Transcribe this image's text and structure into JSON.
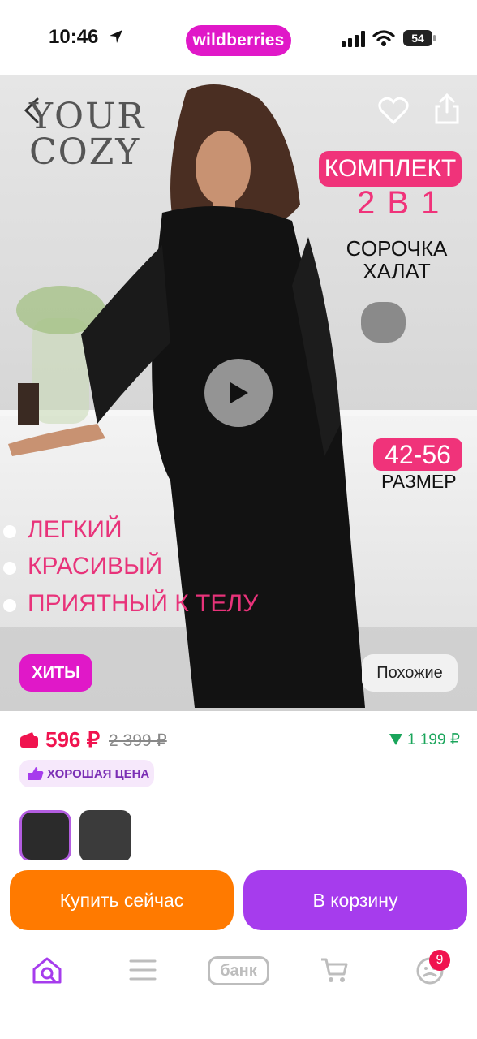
{
  "status_bar": {
    "time": "10:46",
    "app_name": "wildberries",
    "battery": "54"
  },
  "hero": {
    "logo_line1": "YOUR",
    "logo_line2": "COZY",
    "badge_set": "КОМПЛЕКТ",
    "two_in_one": "2 В 1",
    "item1": "СОРОЧКА",
    "item2": "ХАЛАТ",
    "size_range": "42-56",
    "size_label": "РАЗМЕР",
    "features": [
      "ЛЕГКИЙ",
      "КРАСИВЫЙ",
      "ПРИЯТНЫЙ К ТЕЛУ"
    ],
    "hits_label": "ХИТЫ",
    "similar_label": "Похожие"
  },
  "price": {
    "current": "596 ₽",
    "old": "2 399 ₽",
    "credit": "1 199 ₽",
    "good_price_label": "ХОРОШАЯ ЦЕНА"
  },
  "actions": {
    "buy_now": "Купить сейчас",
    "add_to_cart": "В корзину"
  },
  "tabbar": {
    "bank_label": "банк",
    "notifications": "9"
  },
  "colors": {
    "brand": "#e018c8",
    "accent_pink": "#f0337a",
    "price_red": "#f0134f",
    "buy_orange": "#ff7a00",
    "cart_purple": "#a63ced",
    "credit_green": "#1aa55b"
  },
  "icons": [
    "location-arrow-icon",
    "signal-icon",
    "wifi-icon",
    "battery-icon",
    "back-icon",
    "heart-icon",
    "share-icon",
    "play-icon",
    "wallet-icon",
    "thumbs-up-icon",
    "home-search-icon",
    "menu-icon",
    "cart-icon",
    "profile-icon"
  ]
}
